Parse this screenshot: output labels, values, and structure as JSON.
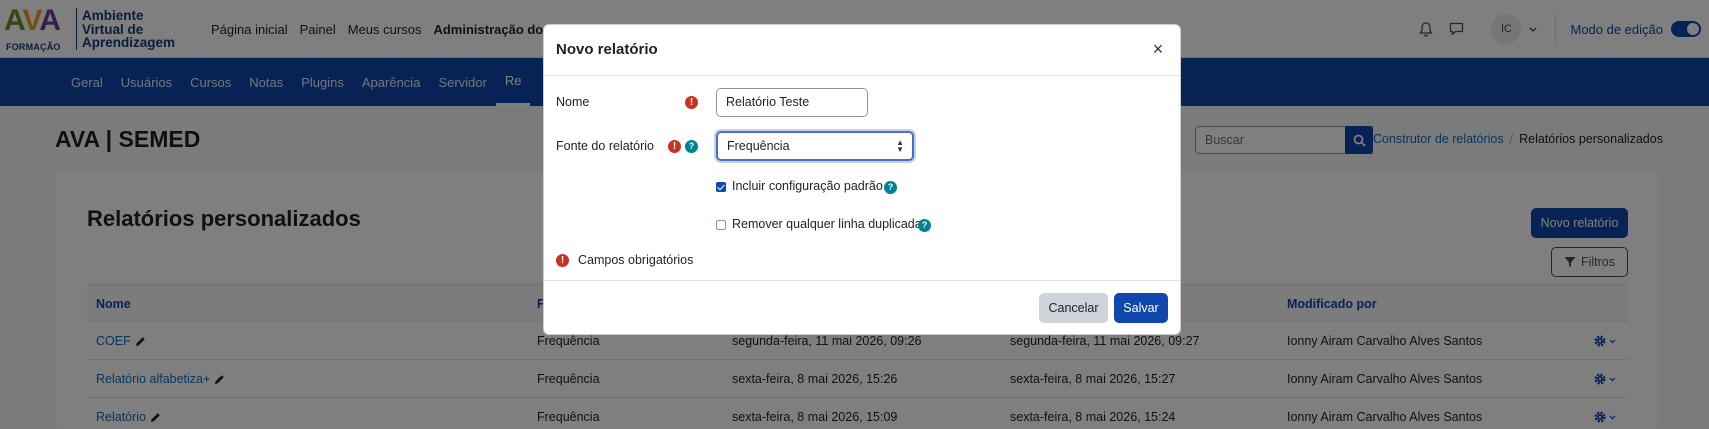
{
  "logo": {
    "brand": "AVA",
    "brand_sub": "FORMAÇÃO",
    "name_line1": "Ambiente",
    "name_line2": "Virtual de",
    "name_line3": "Aprendizagem"
  },
  "topnav": {
    "items": [
      "Página inicial",
      "Painel",
      "Meus cursos",
      "Administração do site"
    ],
    "active_index": 3
  },
  "user": {
    "initials": "IC"
  },
  "edit_mode": {
    "label": "Modo de edição",
    "enabled": true
  },
  "secnav": {
    "items": [
      "Geral",
      "Usuários",
      "Cursos",
      "Notas",
      "Plugins",
      "Aparência",
      "Servidor",
      "Re"
    ],
    "active_index": 7
  },
  "page": {
    "title": "AVA | SEMED"
  },
  "search": {
    "placeholder": "Buscar"
  },
  "breadcrumb": {
    "parent": "Construtor de relatórios",
    "current": "Relatórios personalizados"
  },
  "card": {
    "title": "Relatórios personalizados",
    "new_button": "Novo relatório",
    "filters_button": "Filtros"
  },
  "table": {
    "headers": [
      "Nome",
      "F",
      "",
      "",
      "Modificado por",
      ""
    ],
    "rows": [
      {
        "name": "COEF",
        "source": "Frequência",
        "created": "segunda-feira, 11 mai 2026, 09:26",
        "modified": "segunda-feira, 11 mai 2026, 09:27",
        "by": "Ionny Airam Carvalho Alves Santos"
      },
      {
        "name": "Relatório alfabetiza+",
        "source": "Frequência",
        "created": "sexta-feira, 8 mai 2026, 15:26",
        "modified": "sexta-feira, 8 mai 2026, 15:27",
        "by": "Ionny Airam Carvalho Alves Santos"
      },
      {
        "name": "Relatório",
        "source": "Frequência",
        "created": "sexta-feira, 8 mai 2026, 15:09",
        "modified": "sexta-feira, 8 mai 2026, 15:24",
        "by": "Ionny Airam Carvalho Alves Santos"
      }
    ]
  },
  "modal": {
    "title": "Novo relatório",
    "close_symbol": "×",
    "name_label": "Nome",
    "name_value": "Relatório Teste",
    "source_label": "Fonte do relatório",
    "source_value": "Frequência",
    "default_config_label": "Incluir configuração padrão",
    "default_config_checked": true,
    "remove_duplicates_label": "Remover qualquer linha duplicada",
    "remove_duplicates_checked": false,
    "required_note": "Campos obrigatórios",
    "required_symbol": "!",
    "help_symbol": "?",
    "cancel": "Cancelar",
    "save": "Salvar"
  },
  "colors": {
    "primary": "#0f47ad",
    "danger": "#ca3120",
    "info": "#008196",
    "link": "#0f6cbf"
  }
}
